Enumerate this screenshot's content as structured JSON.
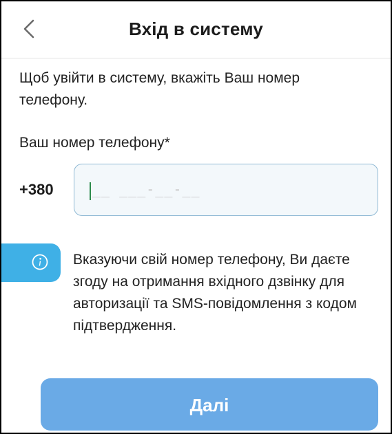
{
  "header": {
    "back_icon": "chevron-left-icon",
    "title": "Вхід в систему"
  },
  "intro_text": "Щоб увійти в систему, вкажіть Ваш номер телефону.",
  "phone": {
    "label": "Ваш номер телефону*",
    "prefix": "+380",
    "value": "",
    "mask": "__ ___-__-__"
  },
  "info": {
    "icon": "info-icon",
    "text": "Вказуючи свій номер телефону, Ви даєте згоду на отримання вхідного дзвінку для авторизації та SMS-повідомлення з кодом підтвердження."
  },
  "next_button_label": "Далі",
  "colors": {
    "accent": "#3fb0e6",
    "button": "#6aaae6",
    "input_border": "#8fb9d4",
    "caret": "#2c8a4c"
  }
}
